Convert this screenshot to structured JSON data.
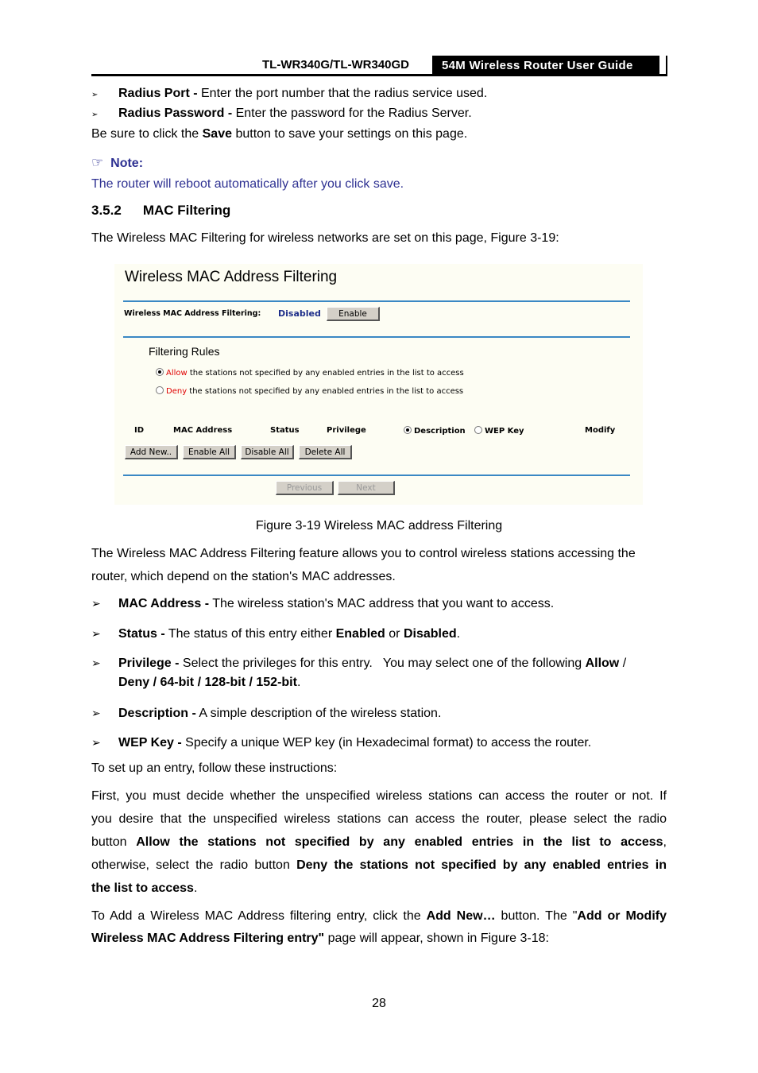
{
  "header": {
    "model": "TL-WR340G/TL-WR340GD",
    "guide_title": "54M Wireless Router User Guide"
  },
  "top_bullets": [
    {
      "term": "Radius Port -",
      "text": " Enter the port number that the radius service used."
    },
    {
      "term": "Radius Password -",
      "text": " Enter the password for the Radius Server."
    }
  ],
  "save_line": {
    "pre": "Be sure to click the ",
    "bold": "Save",
    "post": " button to save your settings on this page."
  },
  "note": {
    "icon": "pointing-hand-icon",
    "label": "Note:",
    "text": "The router will reboot automatically after you click save."
  },
  "section": {
    "number": "3.5.2",
    "title": "MAC Filtering"
  },
  "intro": "The Wireless MAC Filtering for wireless networks are set on this page, Figure 3-19:",
  "figure": {
    "title": "Wireless MAC Address Filtering",
    "filter_label": "Wireless MAC Address Filtering:",
    "filter_status": "Disabled",
    "enable_button": "Enable",
    "rules_heading": "Filtering Rules",
    "rules": [
      {
        "keyword": "Allow",
        "text": " the stations not specified by any enabled entries in the list to access",
        "selected": true
      },
      {
        "keyword": "Deny",
        "text": " the stations not specified by any enabled entries in the list to access",
        "selected": false
      }
    ],
    "columns": {
      "id": "ID",
      "mac": "MAC Address",
      "status": "Status",
      "privilege": "Privilege",
      "description": "Description",
      "wep_key": "WEP Key",
      "modify": "Modify"
    },
    "buttons": {
      "add_new": "Add New..",
      "enable_all": "Enable All",
      "disable_all": "Disable All",
      "delete_all": "Delete All",
      "previous": "Previous",
      "next": "Next"
    },
    "colors": {
      "accent_rule": "#3a88c4",
      "status_text": "#1f2f8a",
      "rule_keyword": "#e00000",
      "background": "#fdfdf3"
    }
  },
  "caption": "Figure 3-19 Wireless MAC address Filtering",
  "desc_para": {
    "line1": "The Wireless MAC Address Filtering feature allows you to control wireless stations accessing the",
    "line2": "router, which depend on the station's MAC addresses."
  },
  "field_bullets": [
    {
      "term": "MAC Address -",
      "text": " The wireless station's MAC address that you want to access."
    },
    {
      "term": "Status -",
      "text": " The status of this entry either ",
      "b1": "Enabled",
      "mid": " or ",
      "b2": "Disabled",
      "end": "."
    },
    {
      "term": "Privilege -",
      "text": " Select the privileges for this entry.   You may select one of the following ",
      "b1": "Allow",
      "mid": " /",
      "line2": "Deny / 64-bit / 128-bit / 152-bit",
      "end": "."
    },
    {
      "term": "Description -",
      "text": " A simple description of the wireless station."
    },
    {
      "term": "WEP Key -",
      "text": " Specify a unique WEP key (in Hexadecimal format) to access the router."
    }
  ],
  "setup_intro": "To set up an entry, follow these instructions:",
  "first_para": {
    "l1": "First, you must decide whether the unspecified wireless stations can access the router or not. If",
    "l2": "you desire that the unspecified wireless stations can access the router, please select the radio",
    "l3_pre": "button ",
    "l3_bold": "Allow the stations not specified by any enabled entries in the list to access",
    "l3_post": ",",
    "l4_pre": "otherwise, select the radio button ",
    "l4_bold": "Deny the stations not specified by any enabled entries in",
    "l5_bold": "the list to access",
    "l5_post": "."
  },
  "add_para": {
    "pre": "To Add a Wireless MAC Address filtering entry, click the ",
    "b1": "Add New…",
    "mid": " button. The \"",
    "b2": "Add or Modify",
    "l2_bold": "Wireless MAC Address Filtering entry\"",
    "l2_post": " page will appear, shown in Figure 3-18:"
  },
  "page_number": "28"
}
